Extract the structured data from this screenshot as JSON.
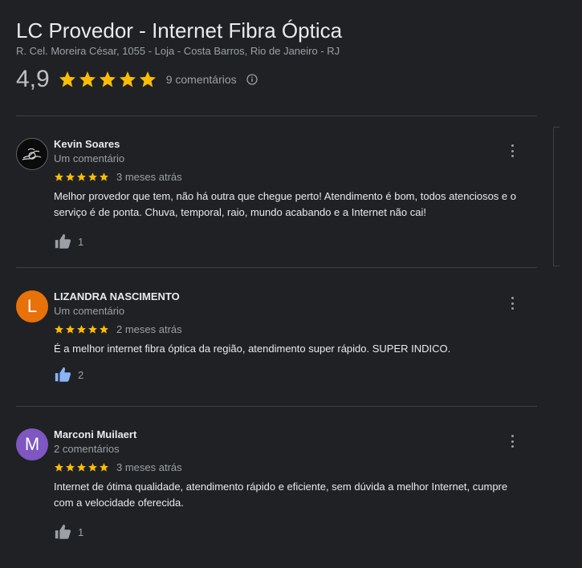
{
  "header": {
    "title": "LC Provedor - Internet Fibra Óptica",
    "address": "R. Cel. Moreira César, 1055 - Loja - Costa Barros, Rio de Janeiro - RJ",
    "rating": "4,9",
    "rating_stars": 5,
    "review_count": "9 comentários"
  },
  "colors": {
    "star": "#fbbc04",
    "background": "#202124",
    "liked": "#8ab4f8"
  },
  "reviews": [
    {
      "name": "Kevin Soares",
      "sub": "Um comentário",
      "stars": 5,
      "time": "3 meses atrás",
      "text": "Melhor provedor que tem, não há outra que chegue perto! Atendimento é bom, todos atenciosos e o serviço é de ponta. Chuva, temporal, raio, mundo acabando e a Internet não cai!",
      "likes": "1",
      "avatar": "photo"
    },
    {
      "name": "LIZANDRA NASCIMENTO",
      "sub": "Um comentário",
      "stars": 5,
      "time": "2 meses atrás",
      "text": "É a melhor internet fibra óptica da região, atendimento super rápido. SUPER INDICO.",
      "likes": "2",
      "avatar_letter": "L",
      "avatar_color": "#e8710a"
    },
    {
      "name": "Marconi Muilaert",
      "sub": "2 comentários",
      "stars": 5,
      "time": "3 meses atrás",
      "text": "Internet de ótima qualidade, atendimento rápido e eficiente,  sem dúvida a melhor Internet,  cumpre com a velocidade oferecida.",
      "likes": "1",
      "avatar_letter": "M",
      "avatar_color": "#7e57c2"
    }
  ]
}
